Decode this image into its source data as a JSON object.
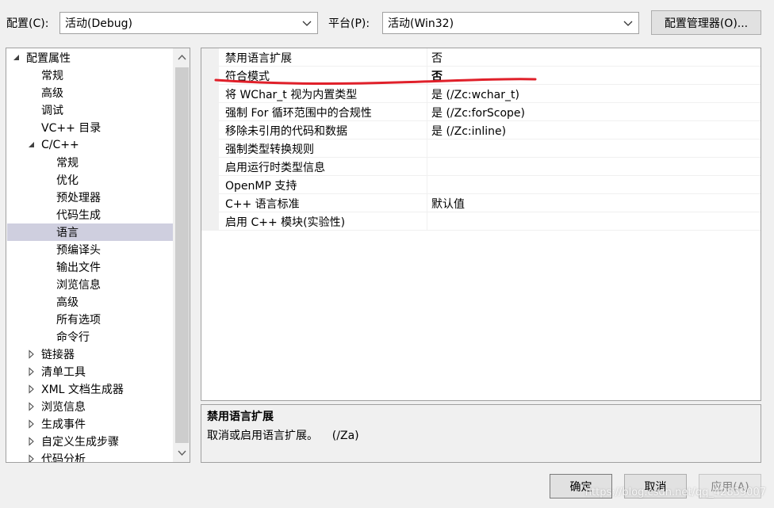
{
  "header": {
    "config_label": "配置(C):",
    "config_value": "活动(Debug)",
    "platform_label": "平台(P):",
    "platform_value": "活动(Win32)",
    "config_manager_button": "配置管理器(O)..."
  },
  "tree": {
    "items": [
      {
        "label": "配置属性",
        "indent": 0,
        "toggle": "expanded"
      },
      {
        "label": "常规",
        "indent": 1,
        "toggle": "none"
      },
      {
        "label": "高级",
        "indent": 1,
        "toggle": "none"
      },
      {
        "label": "调试",
        "indent": 1,
        "toggle": "none"
      },
      {
        "label": "VC++ 目录",
        "indent": 1,
        "toggle": "none"
      },
      {
        "label": "C/C++",
        "indent": 1,
        "toggle": "expanded"
      },
      {
        "label": "常规",
        "indent": 2,
        "toggle": "none"
      },
      {
        "label": "优化",
        "indent": 2,
        "toggle": "none"
      },
      {
        "label": "预处理器",
        "indent": 2,
        "toggle": "none"
      },
      {
        "label": "代码生成",
        "indent": 2,
        "toggle": "none"
      },
      {
        "label": "语言",
        "indent": 2,
        "toggle": "none",
        "selected": true
      },
      {
        "label": "预编译头",
        "indent": 2,
        "toggle": "none"
      },
      {
        "label": "输出文件",
        "indent": 2,
        "toggle": "none"
      },
      {
        "label": "浏览信息",
        "indent": 2,
        "toggle": "none"
      },
      {
        "label": "高级",
        "indent": 2,
        "toggle": "none"
      },
      {
        "label": "所有选项",
        "indent": 2,
        "toggle": "none"
      },
      {
        "label": "命令行",
        "indent": 2,
        "toggle": "none"
      },
      {
        "label": "链接器",
        "indent": 1,
        "toggle": "collapsed"
      },
      {
        "label": "清单工具",
        "indent": 1,
        "toggle": "collapsed"
      },
      {
        "label": "XML 文档生成器",
        "indent": 1,
        "toggle": "collapsed"
      },
      {
        "label": "浏览信息",
        "indent": 1,
        "toggle": "collapsed"
      },
      {
        "label": "生成事件",
        "indent": 1,
        "toggle": "collapsed"
      },
      {
        "label": "自定义生成步骤",
        "indent": 1,
        "toggle": "collapsed"
      },
      {
        "label": "代码分析",
        "indent": 1,
        "toggle": "collapsed"
      }
    ]
  },
  "grid": {
    "rows": [
      {
        "name": "禁用语言扩展",
        "value": "否",
        "bold": false
      },
      {
        "name": "符合模式",
        "value": "否",
        "bold": true
      },
      {
        "name": "将 WChar_t 视为内置类型",
        "value": "是 (/Zc:wchar_t)",
        "bold": false
      },
      {
        "name": "强制 For 循环范围中的合规性",
        "value": "是 (/Zc:forScope)",
        "bold": false
      },
      {
        "name": "移除未引用的代码和数据",
        "value": "是 (/Zc:inline)",
        "bold": false
      },
      {
        "name": "强制类型转换规则",
        "value": "",
        "bold": false
      },
      {
        "name": "启用运行时类型信息",
        "value": "",
        "bold": false
      },
      {
        "name": "OpenMP 支持",
        "value": "",
        "bold": false
      },
      {
        "name": "C++ 语言标准",
        "value": "默认值",
        "bold": false
      },
      {
        "name": "启用 C++ 模块(实验性)",
        "value": "",
        "bold": false
      }
    ]
  },
  "description": {
    "title": "禁用语言扩展",
    "text": "取消或启用语言扩展。    (/Za)"
  },
  "buttons": {
    "ok": "确定",
    "cancel": "取消",
    "apply": "应用(A)"
  },
  "watermark": "https://blog.csdn.net/qq_42839007",
  "colors": {
    "annotation": "#e0202a",
    "selection": "#cfcfdf"
  }
}
